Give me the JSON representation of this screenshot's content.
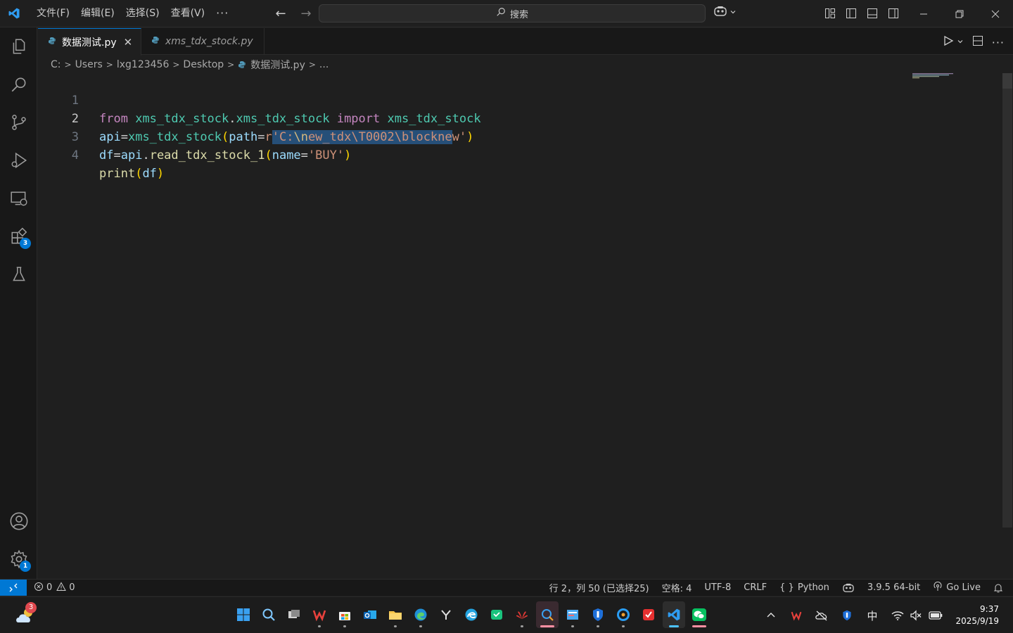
{
  "menu": [
    "文件(F)",
    "编辑(E)",
    "选择(S)",
    "查看(V)"
  ],
  "menu_more": "···",
  "search": {
    "label": "搜索"
  },
  "tabs": [
    {
      "label": "数据测试.py",
      "active": true
    },
    {
      "label": "xms_tdx_stock.py",
      "active": false
    }
  ],
  "tab_close": "✕",
  "breadcrumb": [
    "C:",
    "Users",
    "lxg123456",
    "Desktop",
    "数据测试.py",
    "..."
  ],
  "editor": {
    "line_numbers": [
      "1",
      "2",
      "3",
      "4"
    ],
    "current_line": 2,
    "lines": [
      "from xms_tdx_stock.xms_tdx_stock import xms_tdx_stock",
      "api=xms_tdx_stock(path=r'C:\\new_tdx\\T0002\\blocknew')",
      "df=api.read_tdx_stock_1(name='BUY')",
      "print(df)"
    ]
  },
  "activity_badges": {
    "extensions": "3",
    "settings": "1"
  },
  "status": {
    "errors": "0",
    "warnings": "0",
    "position": "行 2，列 50 (已选择25)",
    "indent": "空格: 4",
    "encoding": "UTF-8",
    "eol": "CRLF",
    "language_braces": "{ }",
    "language": "Python",
    "interpreter": "3.9.5 64-bit",
    "golive": "Go Live"
  },
  "taskbar": {
    "weather_badge": "3",
    "ime": "中",
    "time": "9:37",
    "date": "2025/9/19"
  },
  "colors": {
    "accent": "#0078d4",
    "keyword": "#c586c0",
    "module": "#4ec9b0",
    "string": "#ce9178",
    "function": "#dcdcaa",
    "selection": "#264f78"
  }
}
